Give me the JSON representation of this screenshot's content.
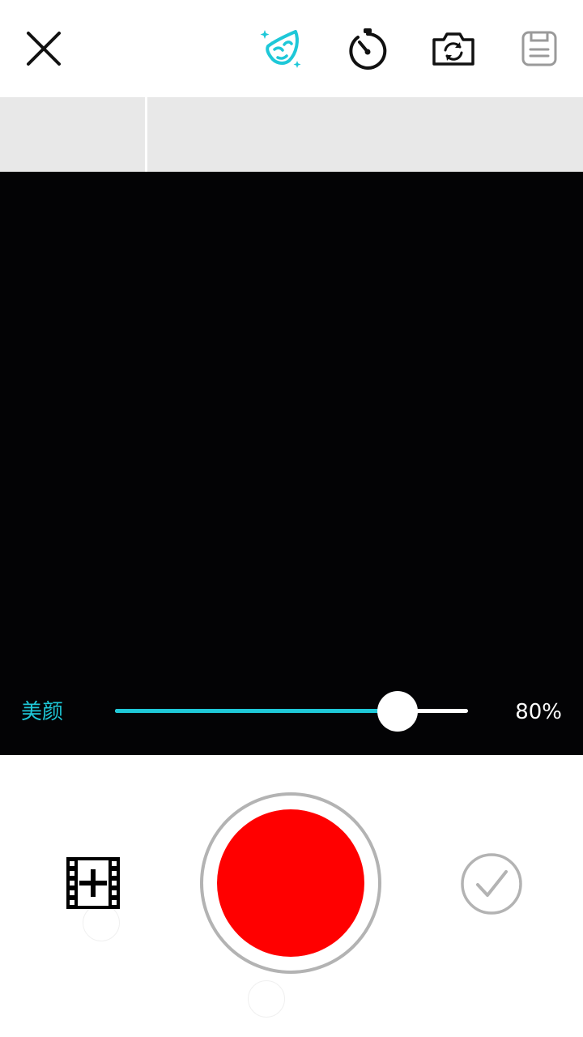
{
  "toolbar": {
    "close_icon": "close-icon",
    "beauty_icon": "beauty-face-icon",
    "timer_icon": "timer-icon",
    "switch_camera_icon": "switch-camera-icon",
    "save_icon": "save-icon",
    "beauty_active_color": "#1ec8d8"
  },
  "beauty": {
    "label": "美颜",
    "level": 0.8,
    "value_text": "80%",
    "fill_color": "#1ec8d8"
  },
  "record": {
    "button_color": "#ff0000",
    "ring_color": "#b3b3b3"
  },
  "bottom": {
    "add_clip_icon": "film-add-icon",
    "confirm_icon": "checkmark-circle-icon"
  }
}
